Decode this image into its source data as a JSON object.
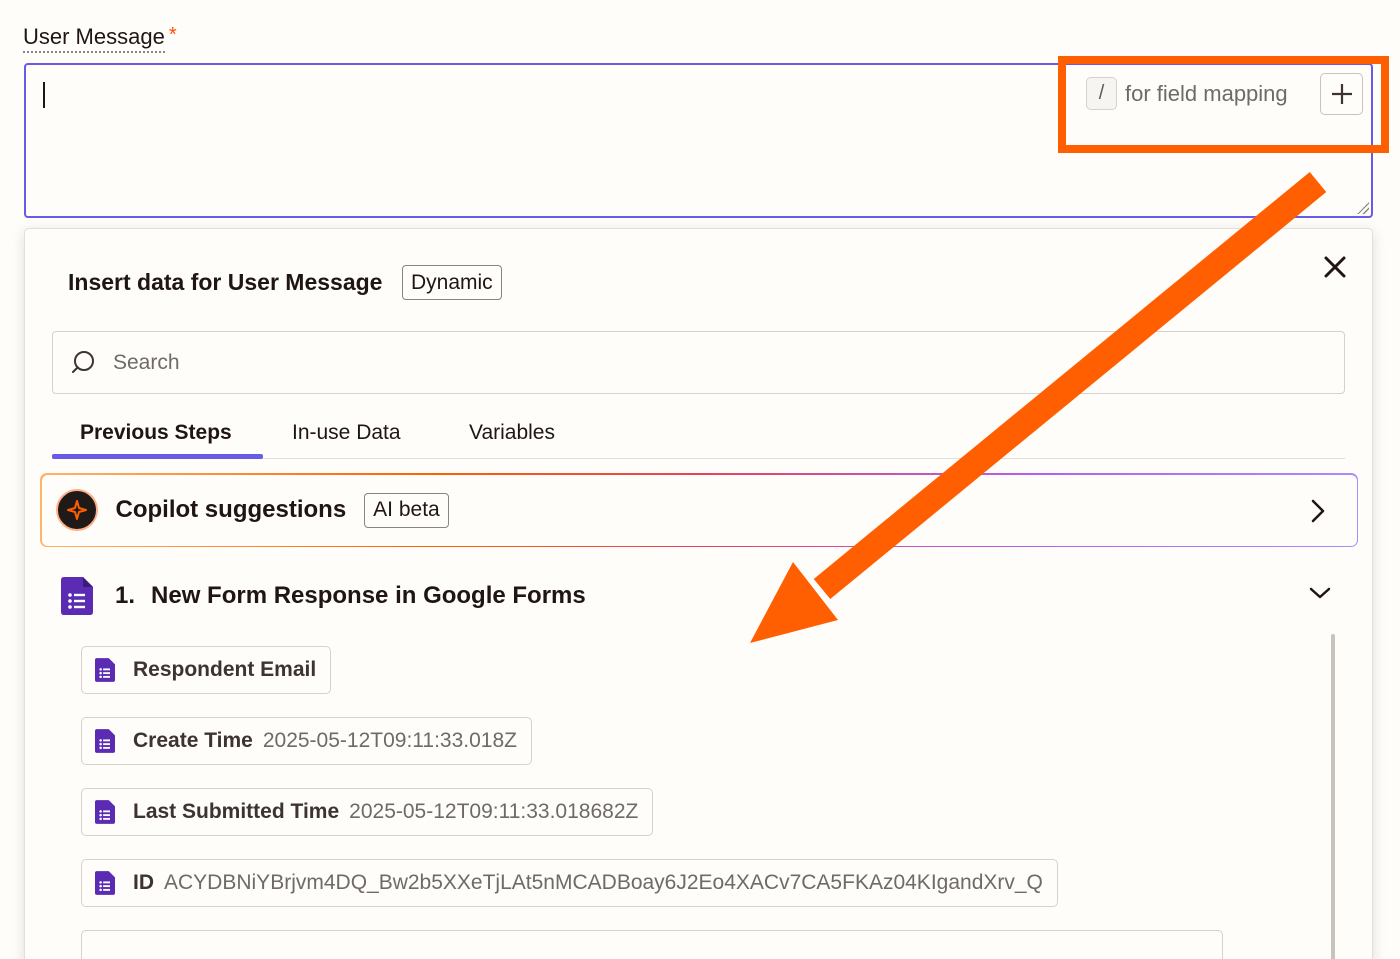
{
  "field": {
    "label": "User Message",
    "required_marker": "*",
    "value": "",
    "hint_key": "/",
    "hint_text": "for field mapping"
  },
  "panel": {
    "title": "Insert data for User Message",
    "badge": "Dynamic",
    "search_placeholder": "Search",
    "tabs": [
      "Previous Steps",
      "In-use Data",
      "Variables"
    ],
    "active_tab": "Previous Steps",
    "copilot": {
      "title": "Copilot suggestions",
      "badge": "AI beta"
    },
    "step": {
      "number": "1.",
      "title": "New Form Response in Google Forms",
      "items": [
        {
          "name": "Respondent Email",
          "value": ""
        },
        {
          "name": "Create Time",
          "value": "2025-05-12T09:11:33.018Z"
        },
        {
          "name": "Last Submitted Time",
          "value": "2025-05-12T09:11:33.018682Z"
        },
        {
          "name": "ID",
          "value": "ACYDBNiYBrjvm4DQ_Bw2b5XXeTjLAt5nMCADBoay6J2Eo4XACv7CA5FKAz04KIgandXrv_Q"
        }
      ]
    }
  },
  "colors": {
    "accent": "#695be8",
    "highlight": "#ff5f00",
    "forms_purple": "#4a1a9e",
    "text": "#201515"
  },
  "icons": [
    "close-icon",
    "search-icon",
    "plus-icon",
    "copilot-icon",
    "chevron-right-icon",
    "chevron-down-icon",
    "google-forms-icon"
  ]
}
